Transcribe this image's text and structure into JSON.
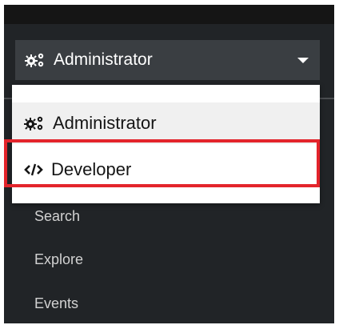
{
  "perspective_switcher": {
    "selected_label": "Administrator",
    "selected_icon": "cogs-icon",
    "caret_icon": "caret-down-icon"
  },
  "perspective_menu": {
    "items": [
      {
        "label": "Administrator",
        "icon": "cogs-icon"
      },
      {
        "label": "Developer",
        "icon": "code-icon"
      }
    ],
    "highlighted_item": "Developer",
    "highlight_color": "#e3242b"
  },
  "nav": {
    "items": [
      {
        "label": "Search"
      },
      {
        "label": "Explore"
      },
      {
        "label": "Events"
      }
    ]
  },
  "colors": {
    "sidebar_bg": "#212427",
    "toggle_bg": "#3a3e42",
    "menu_bg": "#ffffff",
    "menu_selected_bg": "#f0f0f0",
    "nav_text": "#d2d2d2"
  }
}
